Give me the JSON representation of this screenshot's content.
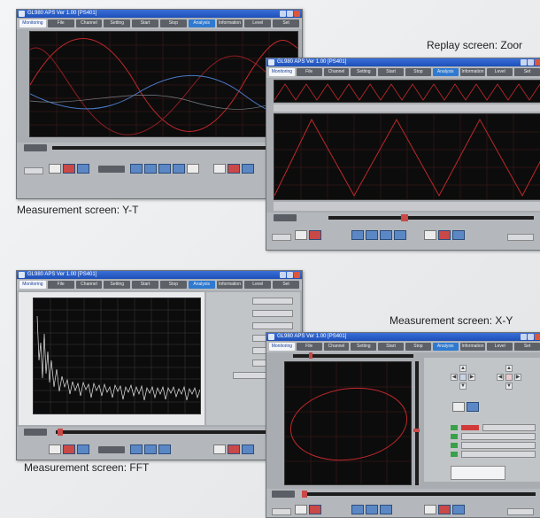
{
  "captions": {
    "yt": "Measurement screen: Y-T",
    "zoom": "Replay screen: Zoor",
    "fft": "Measurement screen: FFT",
    "xy": "Measurement screen: X-Y"
  },
  "app_title": "GL980 APS Ver 1.00 [PS401]",
  "menu": [
    "Monitoring",
    "File",
    "Channel",
    "Setting",
    "Start",
    "Stop",
    "Analysis",
    "Information",
    "Level",
    "Set"
  ],
  "colors": {
    "titlebar": "#1d4fb8",
    "plot_bg": "#0c0c0c",
    "trace_red": "#c0282c",
    "trace_blue": "#4a79c8",
    "trace_white": "#e6e6e6",
    "menu_highlight": "#2f7ad0"
  },
  "icons": [
    "app-icon",
    "minimize-icon",
    "maximize-icon",
    "close-icon",
    "play-icon",
    "stop-icon",
    "zoom-icon",
    "cursor-icon",
    "chart-icon",
    "fft-icon",
    "xy-icon",
    "arrow-up-icon",
    "arrow-down-icon",
    "arrow-left-icon",
    "arrow-right-icon"
  ]
}
